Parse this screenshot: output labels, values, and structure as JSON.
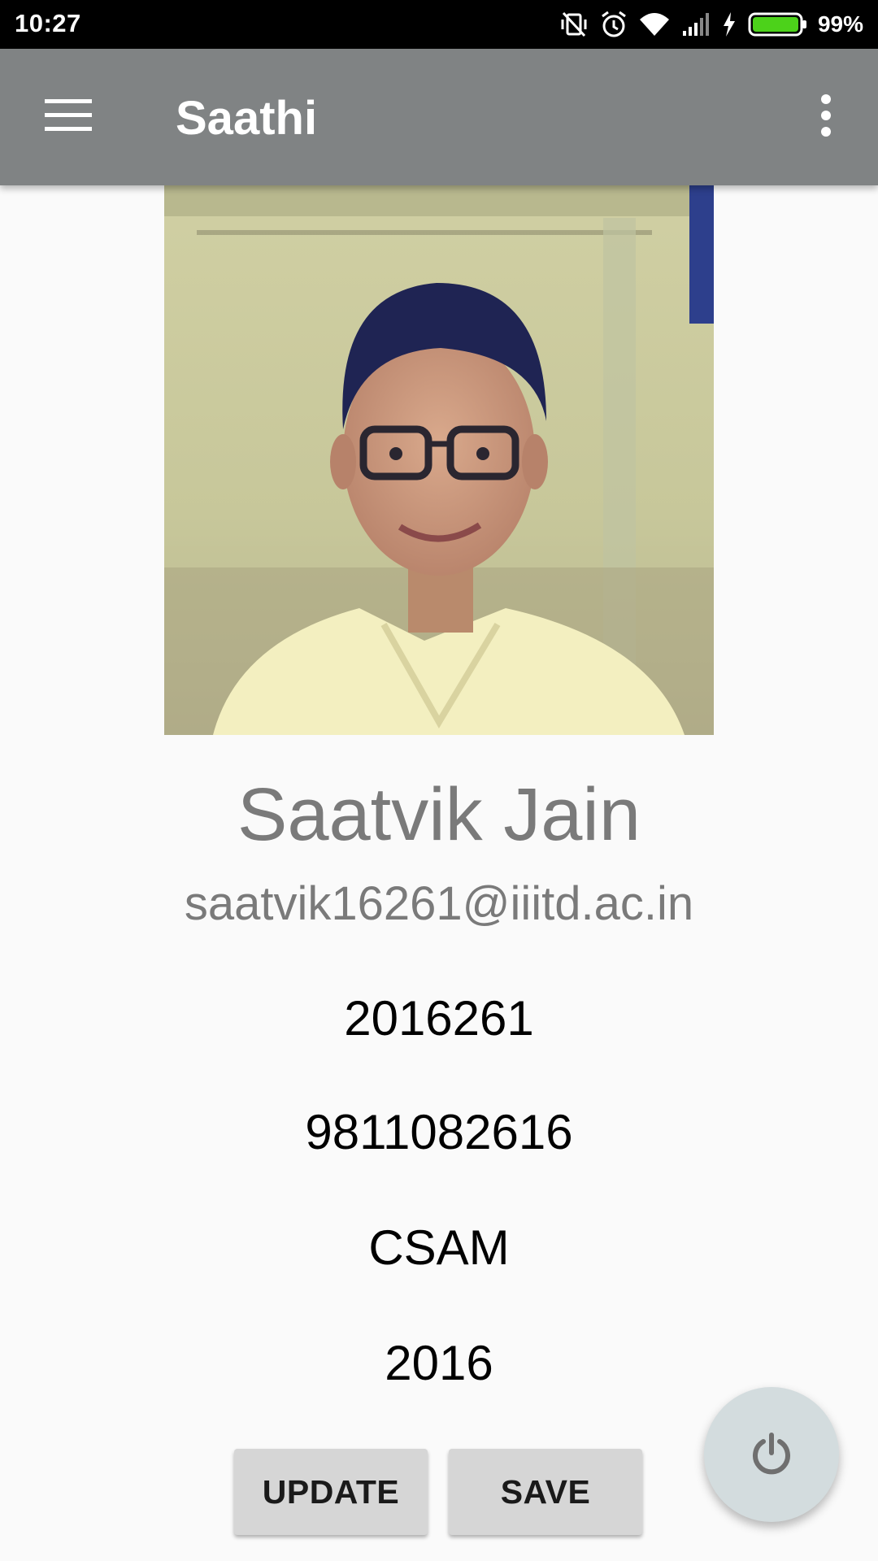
{
  "status_bar": {
    "time": "10:27",
    "battery_percent": "99%",
    "icons": [
      "vibrate-off-icon",
      "alarm-icon",
      "wifi-icon",
      "signal-icon",
      "charging-icon",
      "battery-icon"
    ],
    "battery_color": "#4cd21a"
  },
  "app_bar": {
    "title": "Saathi",
    "background": "#808384",
    "menu_icon": "hamburger-menu-icon",
    "overflow_icon": "more-vert-icon"
  },
  "profile": {
    "name": "Saatvik Jain",
    "email": "saatvik16261@iiitd.ac.in",
    "roll_number": "2016261",
    "phone": "9811082616",
    "branch": "CSAM",
    "year": "2016"
  },
  "actions": {
    "update_label": "UPDATE",
    "save_label": "SAVE",
    "fab_icon": "power-icon"
  }
}
